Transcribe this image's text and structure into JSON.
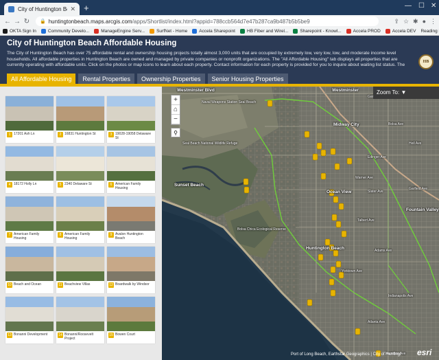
{
  "browser": {
    "tab_title": "City of Huntington Beach Afforda",
    "url_domain": "huntingtonbeach.maps.arcgis.com",
    "url_path": "/apps/Shortlist/index.html?appid=788ccb564d7e47b287ca9b487b5b5be9",
    "bookmarks": [
      {
        "label": "OKTA Sign In",
        "color": "#1a1a1a"
      },
      {
        "label": "Community Develo...",
        "color": "#1e6fd9"
      },
      {
        "label": "ManageEngine Serv...",
        "color": "#d93025"
      },
      {
        "label": "SurfNet - Home",
        "color": "#f29900"
      },
      {
        "label": "Accela Sharepoint",
        "color": "#1e6fd9"
      },
      {
        "label": "HB Fiber and Wirel...",
        "color": "#0b8043"
      },
      {
        "label": "Sharepoint - Knowl...",
        "color": "#0b8043"
      },
      {
        "label": "Accela PROD",
        "color": "#d93025"
      },
      {
        "label": "Accela DEV",
        "color": "#d93025"
      }
    ],
    "reading_list": "Reading list"
  },
  "header": {
    "title": "City of Huntington Beach Affordable Housing",
    "description": "The City of Huntington Beach has over 75 affordable rental and ownership housing projects totally almost 3,000 units that are occupied by extremely low, very low, low, and moderate income level households. All affordable properties in Huntington Beach are owned and managed by private companies or nonprofit organizations. The \"All Affordable Housing\" tab displays all properties that are currently operating with affordable units. Click on the photos or map icons to learn about each property. Contact information for each property is provided for you to inquire about waiting list status. The",
    "logo_text": "HB"
  },
  "tabs": [
    {
      "label": "All Affordable Housing",
      "active": true
    },
    {
      "label": "Rental Properties",
      "active": false
    },
    {
      "label": "Ownership Properties",
      "active": false
    },
    {
      "label": "Senior Housing Properties",
      "active": false
    }
  ],
  "properties": [
    {
      "num": "1",
      "name": "17201 Ash Ln",
      "photo": [
        "#8ab0d8",
        "#c9c2b4",
        "#4f6a3b"
      ]
    },
    {
      "num": "2",
      "name": "16831 Huntington St",
      "photo": [
        "#9fc1e6",
        "#b89a78",
        "#5d7a3e"
      ]
    },
    {
      "num": "3",
      "name": "19028-19058 Delaware St",
      "photo": [
        "#a9c8ea",
        "#d8d3c6",
        "#6c8a45"
      ]
    },
    {
      "num": "4",
      "name": "18172 Holly Ln",
      "photo": [
        "#93b9e2",
        "#e2dcd0",
        "#6a7d52"
      ]
    },
    {
      "num": "5",
      "name": "2340 Delaware St",
      "photo": [
        "#b4cfe9",
        "#ece6d8",
        "#7a8c5a"
      ]
    },
    {
      "num": "6",
      "name": "American Family Housing",
      "photo": [
        "#a6c4e4",
        "#e7e2d6",
        "#55703f"
      ]
    },
    {
      "num": "7",
      "name": "American Family Housing",
      "photo": [
        "#8fb3dc",
        "#cfc6b5",
        "#5f7a46"
      ]
    },
    {
      "num": "8",
      "name": "American Family Housing",
      "photo": [
        "#9dbfe3",
        "#d9cfb9",
        "#6b8049"
      ]
    },
    {
      "num": "9",
      "name": "Avalon Huntington Beach",
      "photo": [
        "#c4d8ec",
        "#b48c6a",
        "#7a7a72"
      ]
    },
    {
      "num": "10",
      "name": "Beach and Ocean",
      "photo": [
        "#86addb",
        "#c9b79e",
        "#5f6f4a"
      ]
    },
    {
      "num": "11",
      "name": "Beachview Villas",
      "photo": [
        "#a0c0e4",
        "#d5cab5",
        "#5b7641"
      ]
    },
    {
      "num": "12",
      "name": "Boardwalk by Windsor",
      "photo": [
        "#9cbde2",
        "#c7a888",
        "#7e7868"
      ]
    },
    {
      "num": "13",
      "name": "Bonanni Development",
      "photo": [
        "#98bce4",
        "#e1ddd4",
        "#63764e"
      ]
    },
    {
      "num": "14",
      "name": "Bonanni/Roosevelt Project",
      "photo": [
        "#a3c3e6",
        "#d9d5cc",
        "#6a7f4f"
      ]
    },
    {
      "num": "15",
      "name": "Bowen Court",
      "photo": [
        "#8cb2dc",
        "#b79c78",
        "#5c7a3d"
      ]
    }
  ],
  "map": {
    "zoom_to": "Zoom To:",
    "zoom_in": "+",
    "zoom_out": "−",
    "home": "⌂",
    "search": "⚲",
    "attribution": "Port of Long Beach, Earthstar Geographics | City of Huntingt",
    "esri": "esri",
    "labels": [
      {
        "text": "Westminster Blvd",
        "small": false
      },
      {
        "text": "Westminster",
        "small": false
      },
      {
        "text": "Garden Grove Fwy",
        "small": true
      },
      {
        "text": "Naval Weapons Station Seal Beach",
        "small": true
      },
      {
        "text": "Seal Beach National Wildlife Refuge",
        "small": true
      },
      {
        "text": "Midway City",
        "small": false
      },
      {
        "text": "Sunset Beach",
        "small": false
      },
      {
        "text": "Bolsa Ave",
        "small": true
      },
      {
        "text": "Edinger Ave",
        "small": true
      },
      {
        "text": "Heil Ave",
        "small": true
      },
      {
        "text": "Warner Ave",
        "small": true
      },
      {
        "text": "Slater Ave",
        "small": true
      },
      {
        "text": "Talbert Ave",
        "small": true
      },
      {
        "text": "Garfield Ave",
        "small": true
      },
      {
        "text": "Yorktown Ave",
        "small": true
      },
      {
        "text": "Adams Ave",
        "small": true
      },
      {
        "text": "Indianapolis Ave",
        "small": true
      },
      {
        "text": "Atlanta Ave",
        "small": true
      },
      {
        "text": "Hamilton Ave",
        "small": true
      },
      {
        "text": "Fountain Valley",
        "small": false
      },
      {
        "text": "Huntington Beach",
        "small": false
      },
      {
        "text": "Bolsa Chica Ecological Reserve",
        "small": true
      },
      {
        "text": "Ocean View",
        "small": false
      }
    ]
  }
}
